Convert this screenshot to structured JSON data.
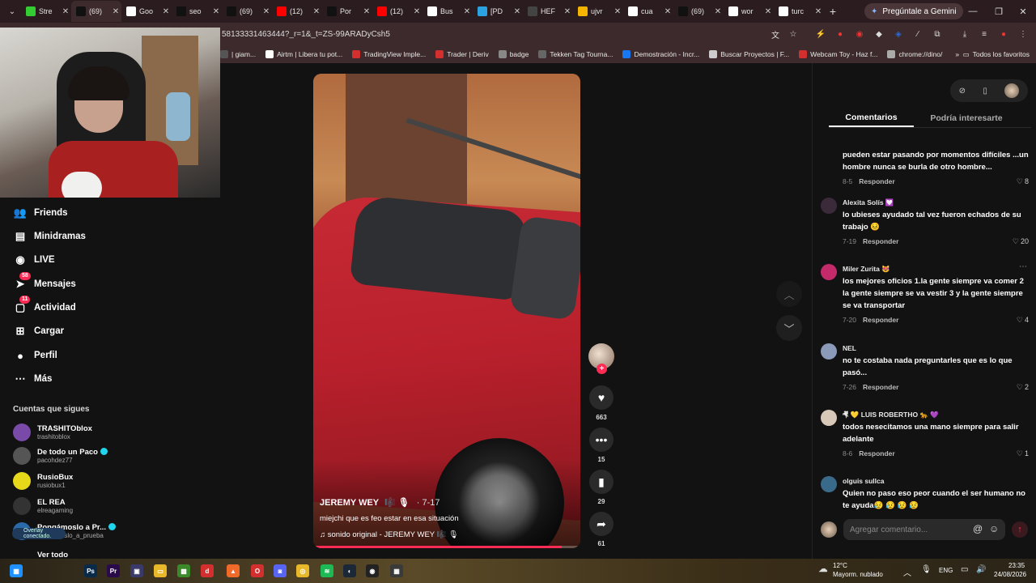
{
  "browser": {
    "tabs": [
      {
        "label": "Stre",
        "icon": "green-square-icon",
        "color": "#33cc33"
      },
      {
        "label": "(69)",
        "icon": "tiktok-icon",
        "color": "#111111",
        "active": true
      },
      {
        "label": "Goo",
        "icon": "google-icon",
        "color": "#ffffff"
      },
      {
        "label": "seo",
        "icon": "tiktok-icon",
        "color": "#111111"
      },
      {
        "label": "(69)",
        "icon": "tiktok-icon",
        "color": "#111111"
      },
      {
        "label": "(12)",
        "icon": "youtube-icon",
        "color": "#ff0000"
      },
      {
        "label": "Por",
        "icon": "tiktok-icon",
        "color": "#111111"
      },
      {
        "label": "(12)",
        "icon": "youtube-icon",
        "color": "#ff0000"
      },
      {
        "label": "Bus",
        "icon": "google-icon",
        "color": "#ffffff"
      },
      {
        "label": "[PD",
        "icon": "telegram-icon",
        "color": "#2aa3e0"
      },
      {
        "label": "HEF",
        "icon": "mask-icon",
        "color": "#444444"
      },
      {
        "label": "ujvr",
        "icon": "folder-icon",
        "color": "#f4b400"
      },
      {
        "label": "cua",
        "icon": "google-icon",
        "color": "#ffffff"
      },
      {
        "label": "(69)",
        "icon": "tiktok-icon",
        "color": "#111111"
      },
      {
        "label": "wor",
        "icon": "google-icon",
        "color": "#ffffff"
      },
      {
        "label": "turc",
        "icon": "google-icon",
        "color": "#ffffff"
      }
    ],
    "new_tab": "+",
    "gemini_label": "Pregúntale a Gemini",
    "url": "58133331463444?_r=1&_t=ZS-99ARADyCsh5",
    "bookmarks": [
      {
        "label": "| giam...",
        "color": "#555555"
      },
      {
        "label": "Airtm | Libera tu pot...",
        "color": "#ffffff"
      },
      {
        "label": "TradingView Imple...",
        "color": "#d32f2f"
      },
      {
        "label": "Trader | Deriv",
        "color": "#d32f2f"
      },
      {
        "label": "badge",
        "color": "#888888"
      },
      {
        "label": "Tekken Tag Tourna...",
        "color": "#666666"
      },
      {
        "label": "Demostración - Incr...",
        "color": "#1877f2"
      },
      {
        "label": "Buscar Proyectos | F...",
        "color": "#cccccc"
      },
      {
        "label": "Webcam Toy - Haz f...",
        "color": "#d32f2f"
      },
      {
        "label": "chrome://dino/",
        "color": "#aaaaaa"
      }
    ],
    "bookmarks_more": "»",
    "all_bookmarks": "Todos los favoritos"
  },
  "sidebar": {
    "nav": [
      {
        "label": "Friends",
        "icon": "friends-icon"
      },
      {
        "label": "Minidramas",
        "icon": "minidramas-icon"
      },
      {
        "label": "LIVE",
        "icon": "live-icon"
      },
      {
        "label": "Mensajes",
        "icon": "messages-icon",
        "badge": "58"
      },
      {
        "label": "Actividad",
        "icon": "activity-icon",
        "badge": "11"
      },
      {
        "label": "Cargar",
        "icon": "upload-icon"
      },
      {
        "label": "Perfil",
        "icon": "profile-icon"
      },
      {
        "label": "Más",
        "icon": "more-icon"
      }
    ],
    "following_title": "Cuentas que sigues",
    "following": [
      {
        "name": "TRASHITOblox",
        "handle": "trashitoblox",
        "color": "#7a4aa8",
        "verified": false
      },
      {
        "name": "De todo un Paco",
        "handle": "pacohdez77",
        "color": "#555555",
        "verified": true
      },
      {
        "name": "RusioBux",
        "handle": "rusiobux1",
        "color": "#e8d81a",
        "verified": false
      },
      {
        "name": "EL REA",
        "handle": "elreagaming",
        "color": "#333333",
        "verified": false
      },
      {
        "name": "Pongámoslo a Pr...",
        "handle": "pongamoslo_a_prueba",
        "color": "#2a6aa8",
        "verified": true
      }
    ],
    "see_all": "Ver todo",
    "overlay_label": "Overlay conectado."
  },
  "video": {
    "author": "JEREMY WEY",
    "author_badge": "🎼 🎙",
    "date": "· 7-17",
    "description": "miejchi que es feo estar en esa situación",
    "sound": "♫  sonido original - JEREMY WEY 🎼 🎙",
    "progress_percent": 93
  },
  "actions": {
    "likes": "663",
    "comments": "15",
    "saves": "29",
    "shares": "61"
  },
  "panel": {
    "tab_comments": "Comentarios",
    "tab_interest": "Podría interesarte",
    "comments": [
      {
        "user": "",
        "text": "pueden estar pasando por momentos difíciles ...un hombre nunca se burla de otro hombre...",
        "date": "8-5",
        "likes": "8",
        "avatar_color": "#4a3a3a"
      },
      {
        "user": "Alexita Solís 💟",
        "text": "lo ubieses ayudado tal vez fueron echados de su trabajo 😣",
        "date": "7-19",
        "likes": "20",
        "avatar_color": "#3a2a3a"
      },
      {
        "user": "Miler Zurita 😻",
        "text": "los mejores oficios 1.la gente siempre va comer 2 la gente siempre se va vestir 3 y la gente siempre se va transportar",
        "date": "7-20",
        "likes": "4",
        "avatar_color": "#c42a6a"
      },
      {
        "user": "NEL",
        "text": "no te costaba nada preguntarles que es lo que pasó...",
        "date": "7-26",
        "likes": "2",
        "avatar_color": "#8a9ab8"
      },
      {
        "user": "🤻 💛 LUIS ROBERTHO 🐆 💜",
        "text": "todos nesecitamos una mano siempre para salir adelante",
        "date": "8-6",
        "likes": "1",
        "avatar_color": "#d8c8b8"
      },
      {
        "user": "olguis sullca",
        "text": "Quien no paso eso peor cuando el ser humano no te ayuda😥 😥 😥 😥",
        "date": "",
        "likes": "",
        "avatar_color": "#3a6a8a"
      }
    ],
    "reply_label": "Responder",
    "add_comment_placeholder": "Agregar comentario..."
  },
  "taskbar": {
    "weather_temp": "12°C",
    "weather_desc": "Mayorm. nublado",
    "lang": "ENG",
    "time": "23:35",
    "date": "24/08/2026"
  }
}
